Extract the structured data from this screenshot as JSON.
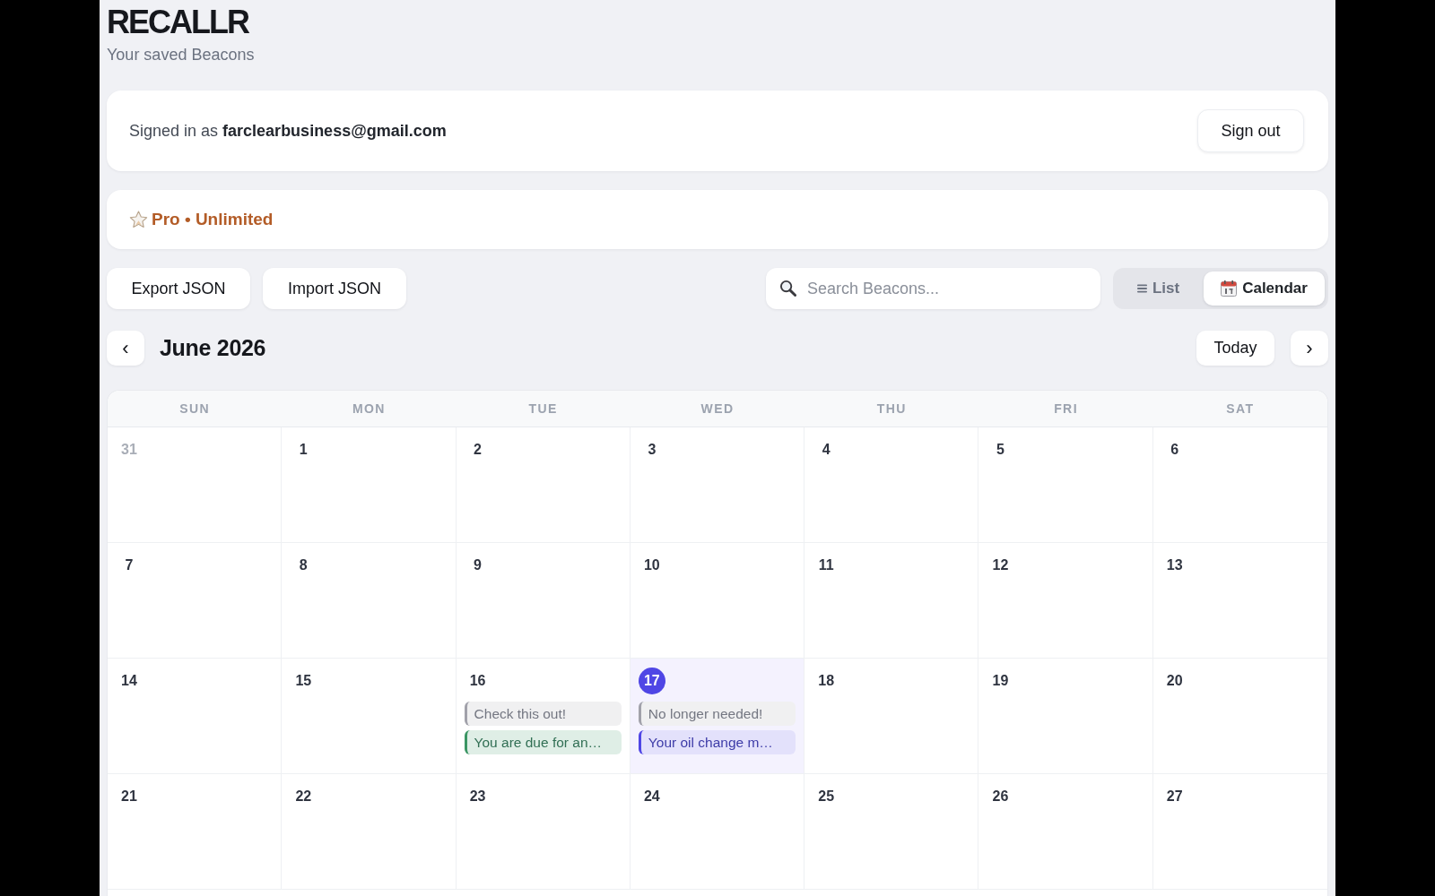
{
  "app": {
    "title": "RECALLR",
    "subtitle": "Your saved Beacons"
  },
  "account": {
    "text": "Signed in as **farclearbusiness@gmail.com**",
    "sign_out": "Sign out"
  },
  "plan": {
    "label": "Pro • Unlimited"
  },
  "toolbar": {
    "buttons": [
      "Export JSON",
      "Import JSON"
    ],
    "search": {
      "placeholder": "Search Beacons..."
    },
    "views": [
      {
        "kind": "list",
        "label": "List",
        "selected": false
      },
      {
        "kind": "calendar",
        "label": "Calendar",
        "selected": true
      }
    ]
  },
  "calendar": {
    "prev": "‹",
    "month": "June 2026",
    "today_button": "Today",
    "next": "›",
    "weekdays": [
      "SUN",
      "MON",
      "TUE",
      "WED",
      "THU",
      "FRI",
      "SAT"
    ],
    "weeks": [
      [
        {
          "date": "31",
          "in_month": false,
          "today": false
        },
        {
          "date": "1",
          "in_month": true,
          "today": false
        },
        {
          "date": "2",
          "in_month": true,
          "today": false
        },
        {
          "date": "3",
          "in_month": true,
          "today": false
        },
        {
          "date": "4",
          "in_month": true,
          "today": false
        },
        {
          "date": "5",
          "in_month": true,
          "today": false
        },
        {
          "date": "6",
          "in_month": true,
          "today": false
        }
      ],
      [
        {
          "date": "7",
          "in_month": true,
          "today": false
        },
        {
          "date": "8",
          "in_month": true,
          "today": false
        },
        {
          "date": "9",
          "in_month": true,
          "today": false
        },
        {
          "date": "10",
          "in_month": true,
          "today": false
        },
        {
          "date": "11",
          "in_month": true,
          "today": false
        },
        {
          "date": "12",
          "in_month": true,
          "today": false
        },
        {
          "date": "13",
          "in_month": true,
          "today": false
        }
      ],
      [
        {
          "date": "14",
          "in_month": true,
          "today": false
        },
        {
          "date": "15",
          "in_month": true,
          "today": false
        },
        {
          "date": "16",
          "in_month": true,
          "today": false,
          "events": [
            {
              "text": "Check this out!",
              "color": "#a1a1aa"
            },
            {
              "text": "You are due for an…",
              "color": "#3a9563"
            }
          ]
        },
        {
          "date": "17",
          "in_month": true,
          "today": true,
          "events": [
            {
              "text": "No longer needed!",
              "color": "#a1a1aa"
            },
            {
              "text": "Your oil change m…",
              "color": "#4f46e5"
            }
          ]
        },
        {
          "date": "18",
          "in_month": true,
          "today": false
        },
        {
          "date": "19",
          "in_month": true,
          "today": false
        },
        {
          "date": "20",
          "in_month": true,
          "today": false
        }
      ],
      [
        {
          "date": "21",
          "in_month": true,
          "today": false
        },
        {
          "date": "22",
          "in_month": true,
          "today": false
        },
        {
          "date": "23",
          "in_month": true,
          "today": false
        },
        {
          "date": "24",
          "in_month": true,
          "today": false
        },
        {
          "date": "25",
          "in_month": true,
          "today": false
        },
        {
          "date": "26",
          "in_month": true,
          "today": false
        },
        {
          "date": "27",
          "in_month": true,
          "today": false
        }
      ]
    ]
  }
}
